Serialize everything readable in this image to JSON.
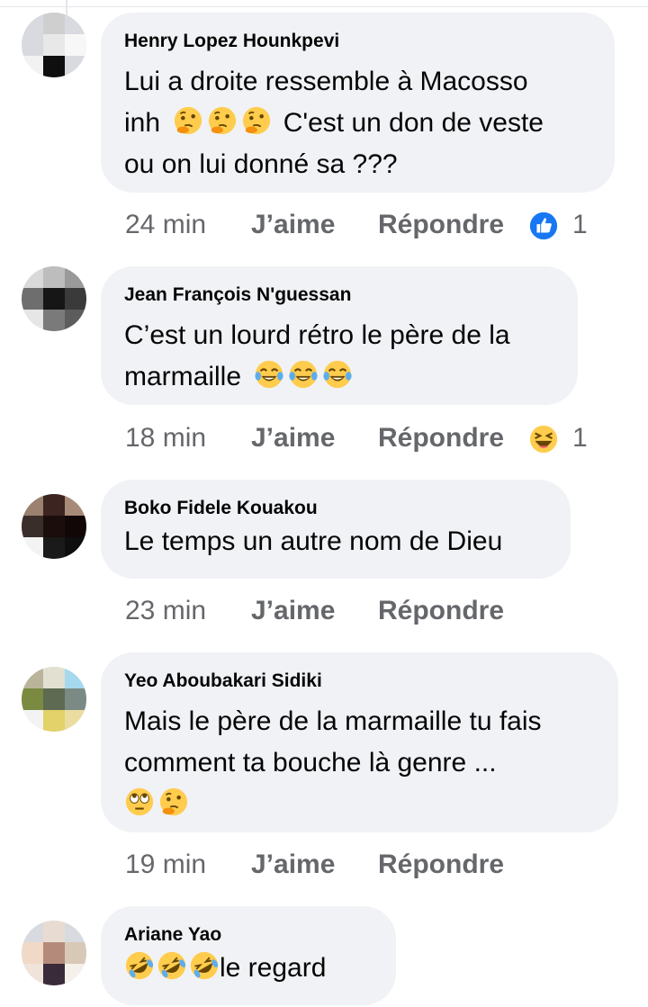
{
  "comments": [
    {
      "author": "Henry Lopez Hounkpevi",
      "lines": [
        "Lui a droite ressemble à Macosso",
        "inh",
        "C'est un don de veste",
        "ou on lui donné sa ???"
      ],
      "emoji_icons": [
        "thinking-face-icon",
        "thinking-face-icon",
        "thinking-face-icon"
      ],
      "time": "24 min",
      "like": "J’aime",
      "reply": "Répondre",
      "reaction_icon": "like-reaction-icon",
      "reaction_count": "1"
    },
    {
      "author": "Jean François N'guessan",
      "lines": [
        "C’est un lourd rétro le père de la",
        "marmaille"
      ],
      "emoji_icons": [
        "tears-of-joy-icon",
        "tears-of-joy-icon",
        "tears-of-joy-icon"
      ],
      "time": "18 min",
      "like": "J’aime",
      "reply": "Répondre",
      "reaction_icon": "haha-reaction-icon",
      "reaction_count": "1"
    },
    {
      "author": "Boko Fidele Kouakou",
      "lines": [
        "Le temps un autre nom de Dieu"
      ],
      "time": "23 min",
      "like": "J’aime",
      "reply": "Répondre"
    },
    {
      "author": "Yeo Aboubakari Sidiki",
      "lines": [
        "Mais le père de la marmaille tu fais",
        "comment ta bouche là genre ..."
      ],
      "emoji_icons": [
        "rolling-eyes-icon",
        "thinking-face-icon"
      ],
      "time": "19 min",
      "like": "J’aime",
      "reply": "Répondre"
    },
    {
      "author": "Ariane Yao",
      "lines": [
        "le regard"
      ],
      "emoji_icons": [
        "rolling-on-floor-laughing-icon",
        "rolling-on-floor-laughing-icon",
        "rolling-on-floor-laughing-icon"
      ]
    }
  ],
  "colors": {
    "bubble": "#f0f2f5",
    "meta_text": "#65676b",
    "like_blue": "#1877f2",
    "emoji_yellow": "#ffcc4d"
  }
}
